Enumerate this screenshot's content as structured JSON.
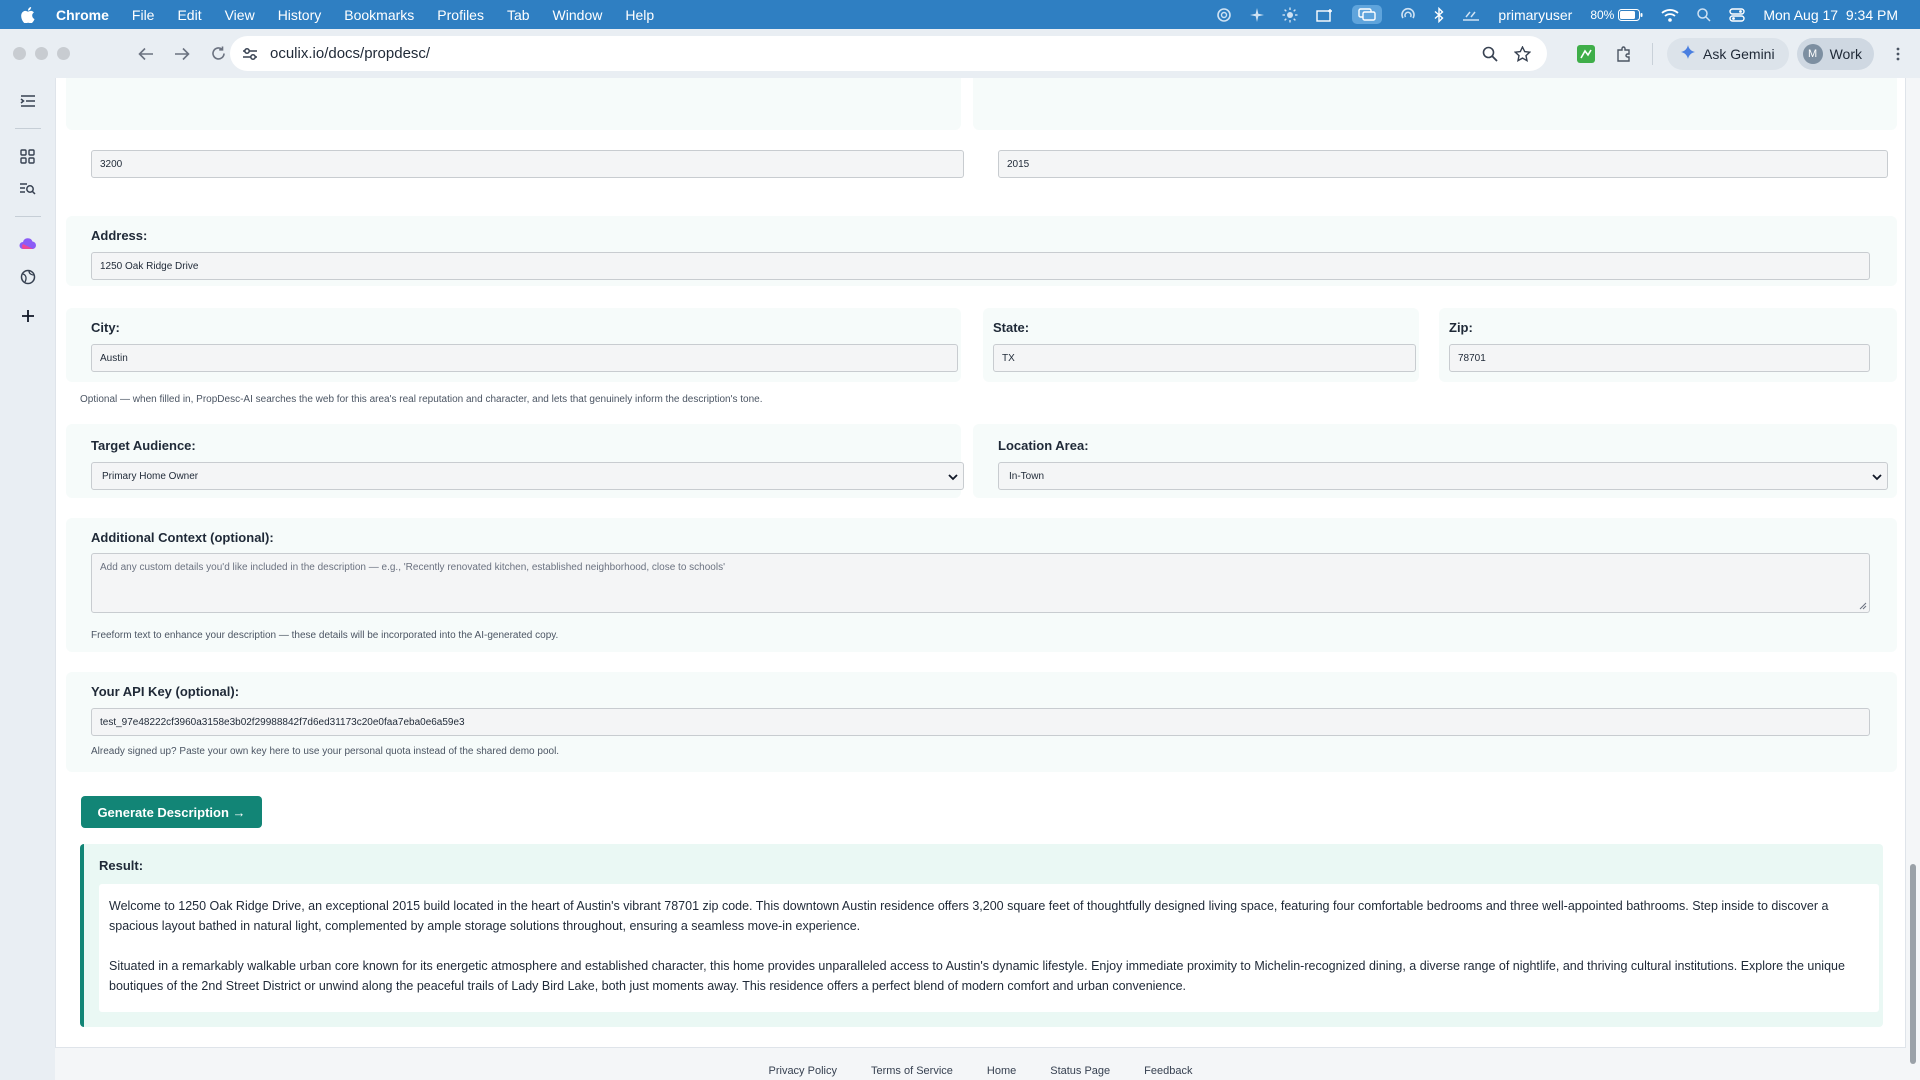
{
  "menubar": {
    "app_name": "Chrome",
    "items": [
      "File",
      "Edit",
      "View",
      "History",
      "Bookmarks",
      "Profiles",
      "Tab",
      "Window",
      "Help"
    ],
    "user": "primaryuser",
    "battery": "80%",
    "datetime": "Mon Aug 17  9:34 PM"
  },
  "browser": {
    "url": "oculix.io/docs/propdesc/",
    "ask_gemini_label": "Ask Gemini",
    "profile_initial": "M",
    "profile_label": "Work"
  },
  "form": {
    "square_feet_value": "3200",
    "year_built_value": "2015",
    "address_label": "Address:",
    "address_value": "1250 Oak Ridge Drive",
    "city_label": "City:",
    "city_value": "Austin",
    "state_label": "State:",
    "state_value": "TX",
    "zip_label": "Zip:",
    "zip_value": "78701",
    "location_hint": "Optional — when filled in, PropDesc-AI searches the web for this area's real reputation and character, and lets that genuinely inform the description's tone.",
    "target_audience_label": "Target Audience:",
    "target_audience_value": "Primary Home Owner",
    "location_area_label": "Location Area:",
    "location_area_value": "In-Town",
    "additional_context_label": "Additional Context (optional):",
    "additional_context_placeholder": "Add any custom details you'd like included in the description — e.g., 'Recently renovated kitchen, established neighborhood, close to schools'",
    "additional_context_hint": "Freeform text to enhance your description — these details will be incorporated into the AI-generated copy.",
    "api_key_label": "Your API Key (optional):",
    "api_key_value": "test_97e48222cf3960a3158e3b02f29988842f7d6ed31173c20e0faa7eba0e6a59e3",
    "api_key_hint": "Already signed up? Paste your own key here to use your personal quota instead of the shared demo pool.",
    "generate_button": "Generate Description →"
  },
  "result": {
    "title": "Result:",
    "paragraph_1": "Welcome to 1250 Oak Ridge Drive, an exceptional 2015 build located in the heart of Austin's vibrant 78701 zip code. This downtown Austin residence offers 3,200 square feet of thoughtfully designed living space, featuring four comfortable bedrooms and three well-appointed bathrooms. Step inside to discover a spacious layout bathed in natural light, complemented by ample storage solutions throughout, ensuring a seamless move-in experience.",
    "paragraph_2": "Situated in a remarkably walkable urban core known for its energetic atmosphere and established character, this home provides unparalleled access to Austin's dynamic lifestyle. Enjoy immediate proximity to Michelin-recognized dining, a diverse range of nightlife, and thriving cultural institutions. Explore the unique boutiques of the 2nd Street District or unwind along the peaceful trails of Lady Bird Lake, both just moments away. This residence offers a perfect blend of modern comfort and urban convenience."
  },
  "footer": {
    "links": [
      "Privacy Policy",
      "Terms of Service",
      "Home",
      "Status Page",
      "Feedback"
    ]
  },
  "colors": {
    "menubar": "#2f7fc2",
    "accent": "#128576",
    "result_bg": "#eaf8f4"
  }
}
